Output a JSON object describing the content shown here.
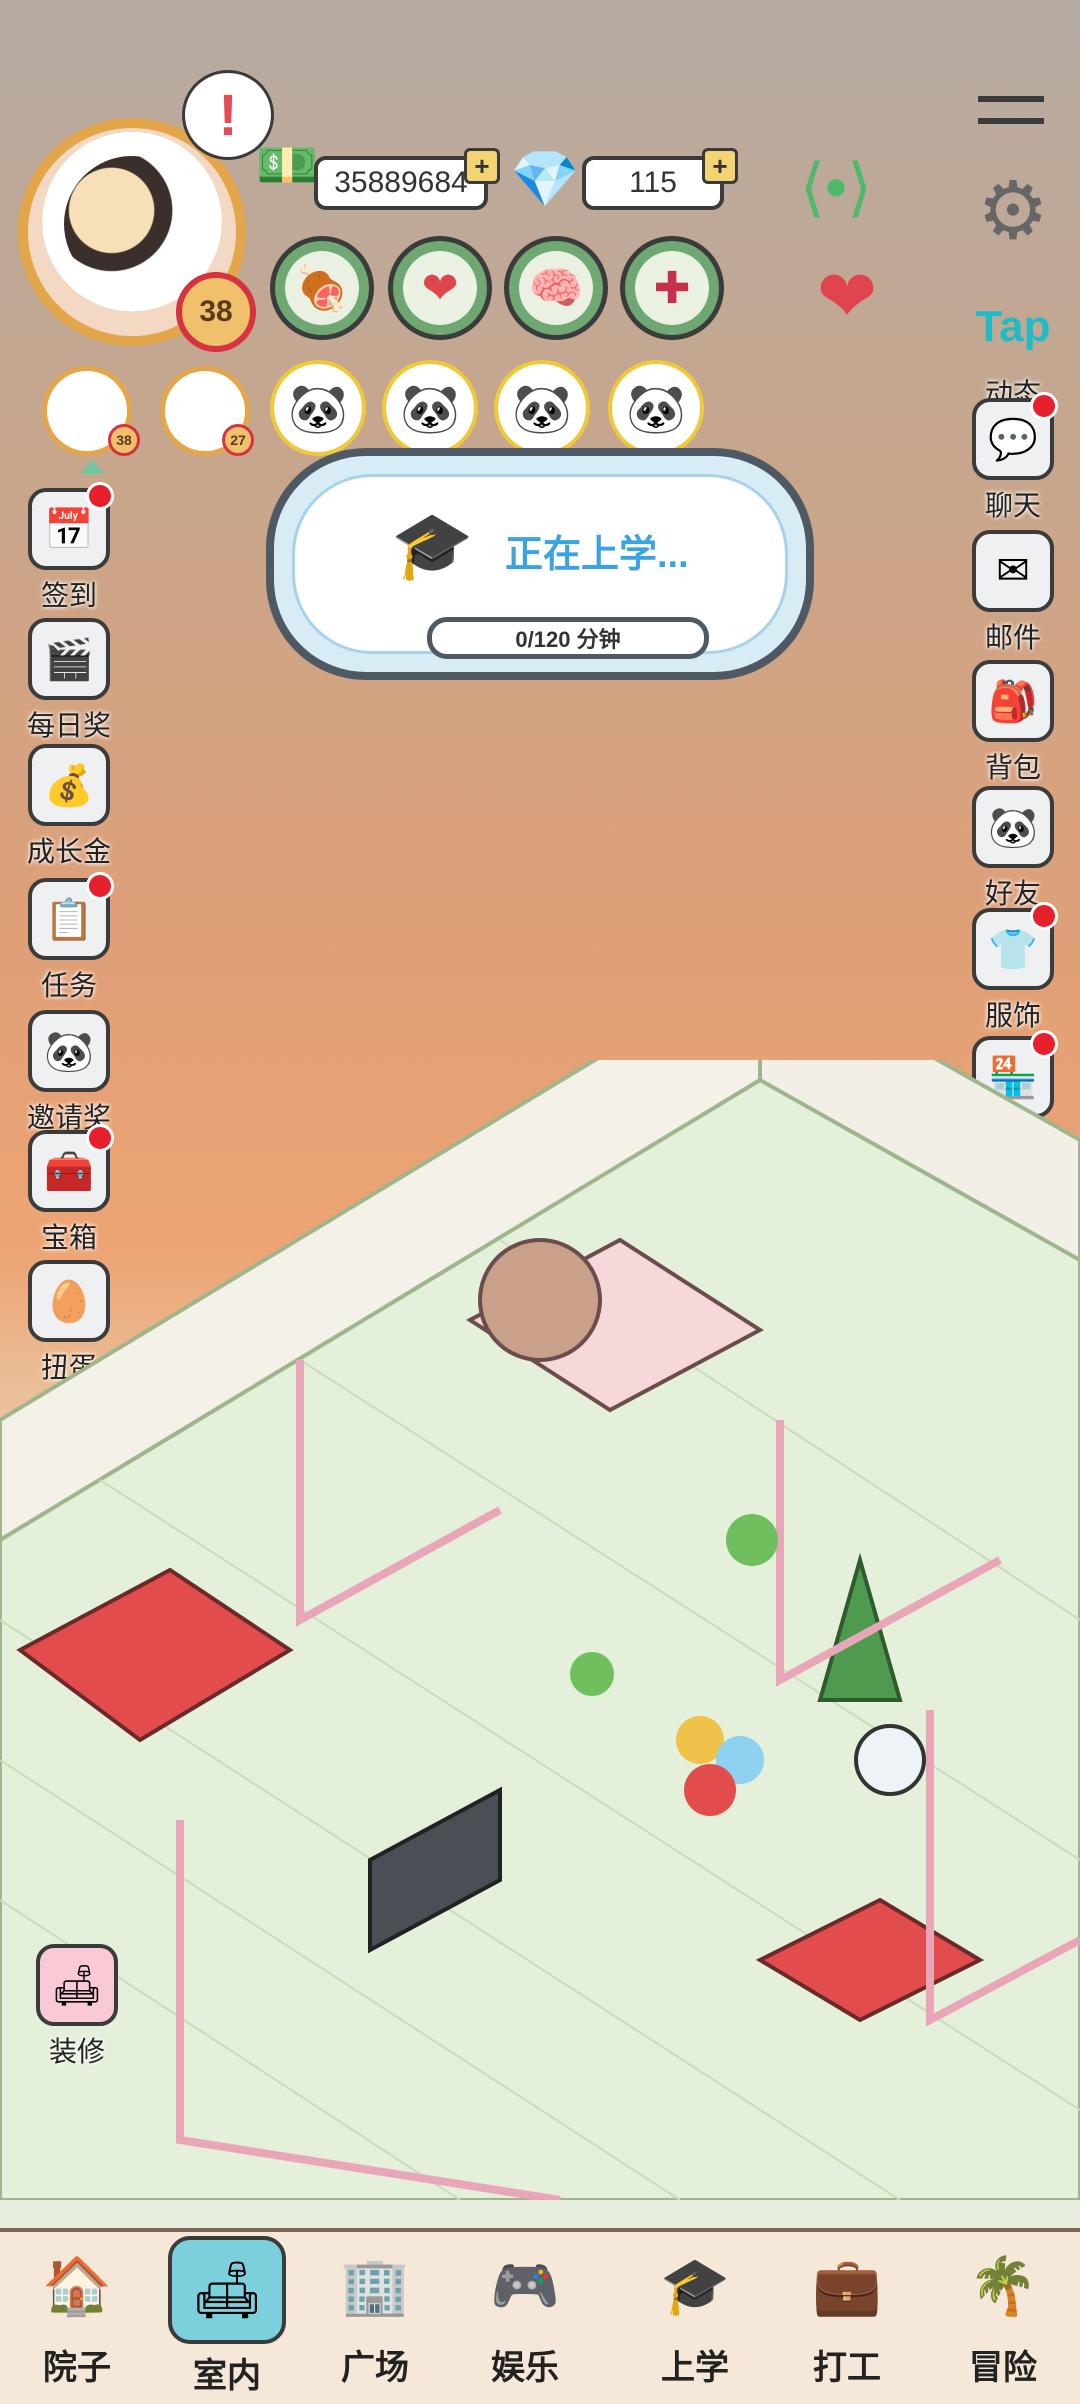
{
  "header": {
    "player_level": "38",
    "money": "35889684",
    "diamonds": "115",
    "currency_plus": "+",
    "exclaim": "!"
  },
  "stats": [
    {
      "name": "food",
      "icon": "🍖"
    },
    {
      "name": "mood",
      "icon": "❤"
    },
    {
      "name": "intellect",
      "icon": "🧠"
    },
    {
      "name": "health",
      "icon": "✚"
    }
  ],
  "family": [
    {
      "level": "38"
    },
    {
      "level": "27"
    }
  ],
  "status": {
    "title": "正在上学...",
    "progress_text": "0/120 分钟",
    "progress": 0
  },
  "left_menu": [
    {
      "label": "签到",
      "icon": "📅",
      "dot": true
    },
    {
      "label": "每日奖",
      "icon": "🎬",
      "dot": false
    },
    {
      "label": "成长金",
      "icon": "💰",
      "dot": false
    },
    {
      "label": "任务",
      "icon": "📋",
      "dot": true
    },
    {
      "label": "邀请奖",
      "icon": "🐼",
      "dot": false
    },
    {
      "label": "宝箱",
      "icon": "🧰",
      "dot": true
    },
    {
      "label": "扭蛋",
      "icon": "🥚",
      "dot": false
    }
  ],
  "right_menu": [
    {
      "label": "动态",
      "icon": "Tap",
      "dot": false
    },
    {
      "label": "聊天",
      "icon": "💬",
      "dot": true
    },
    {
      "label": "邮件",
      "icon": "✉",
      "dot": false
    },
    {
      "label": "背包",
      "icon": "🎒",
      "dot": false
    },
    {
      "label": "好友",
      "icon": "🐼",
      "dot": false
    },
    {
      "label": "服饰",
      "icon": "👕",
      "dot": true
    },
    {
      "label": "商城",
      "icon": "🏪",
      "dot": true
    }
  ],
  "decorate": {
    "label": "装修"
  },
  "nav": [
    {
      "label": "院子",
      "icon": "🏠",
      "active": false
    },
    {
      "label": "室内",
      "icon": "🛋",
      "active": true
    },
    {
      "label": "广场",
      "icon": "🏢",
      "active": false
    },
    {
      "label": "娱乐",
      "icon": "🎮",
      "active": false
    },
    {
      "label": "上学",
      "icon": "🎓",
      "active": false
    },
    {
      "label": "打工",
      "icon": "💼",
      "active": false
    },
    {
      "label": "冒险",
      "icon": "🌴",
      "active": false
    }
  ],
  "colors": {
    "accent": "#3ba3e0",
    "badge_red": "#e51f2c",
    "stat_green": "#6fa873"
  }
}
